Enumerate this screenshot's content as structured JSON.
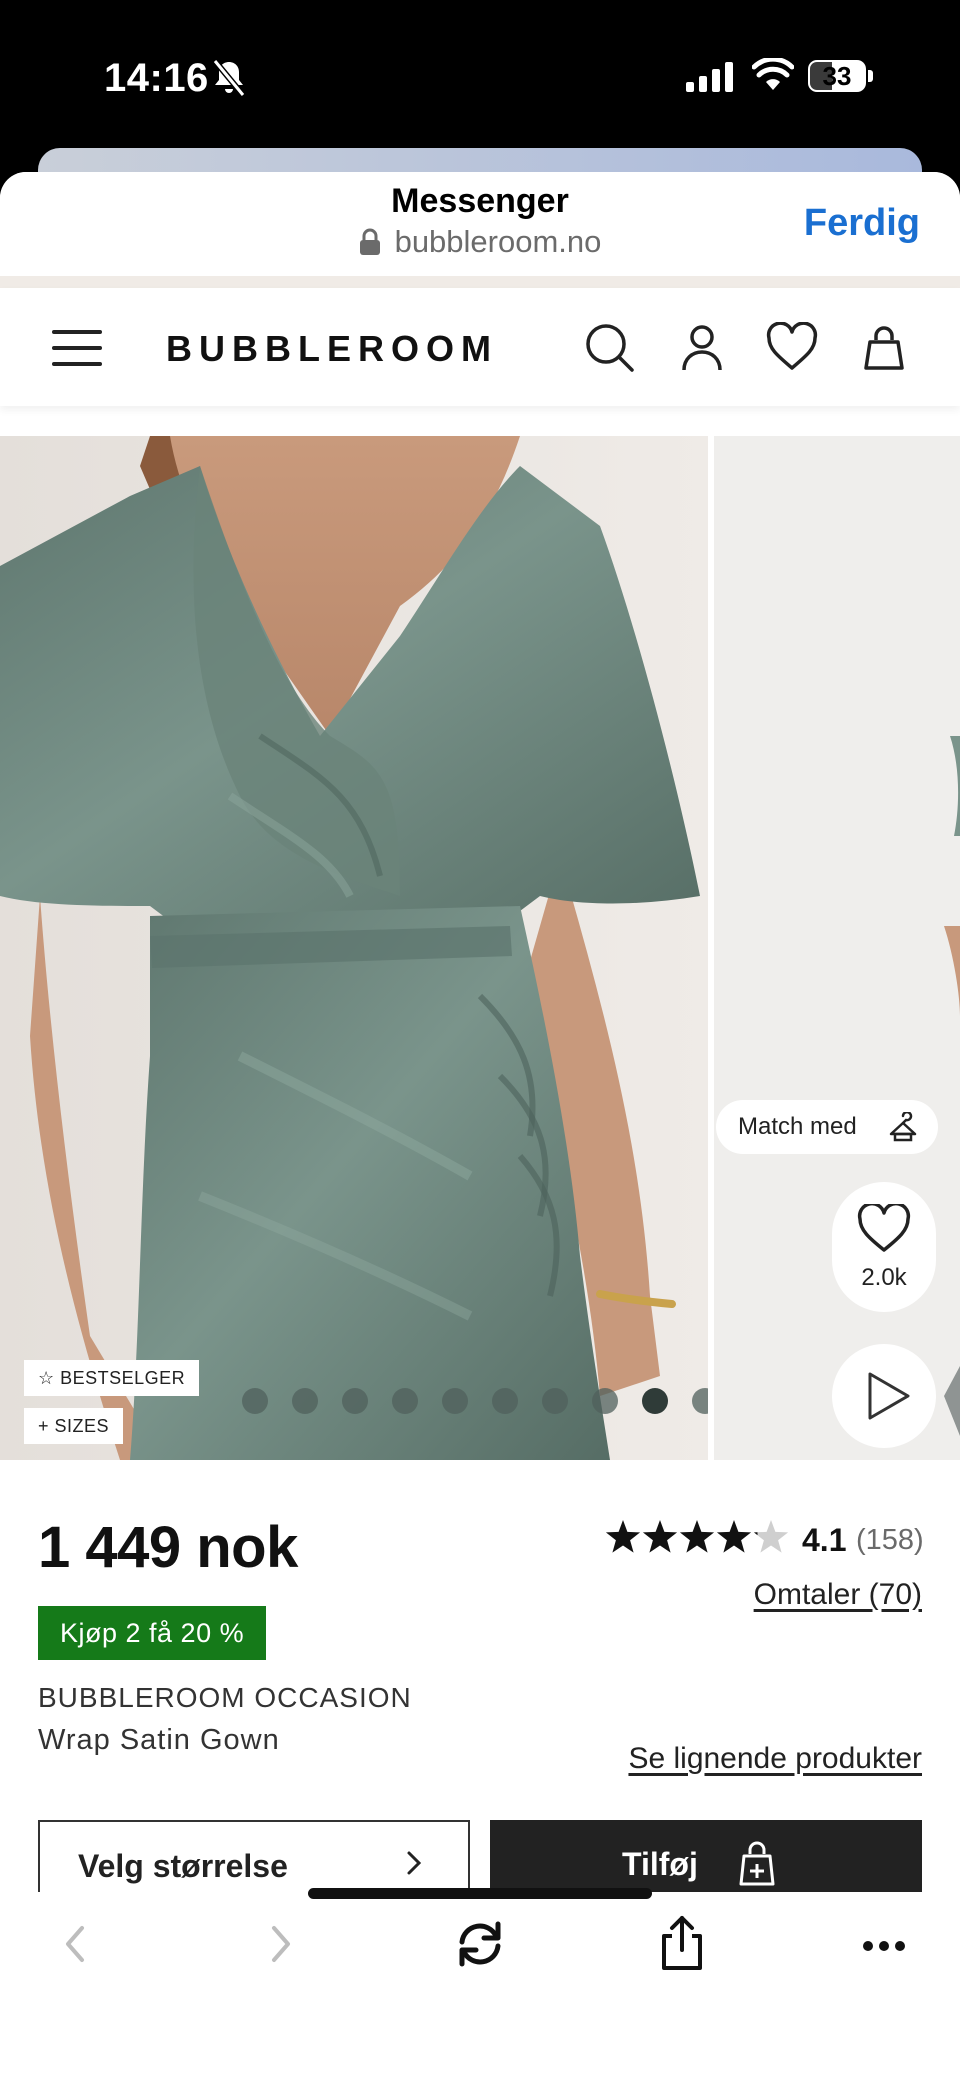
{
  "status_bar": {
    "time": "14:16",
    "battery": "33"
  },
  "browser": {
    "title": "Messenger",
    "url": "bubbleroom.no",
    "done_label": "Ferdig"
  },
  "site": {
    "logo": "BUBBLEROOM"
  },
  "gallery": {
    "badges": {
      "bestseller": "BESTSELGER",
      "sizes": "SIZES"
    },
    "match_label": "Match med",
    "wishlist_count": "2.0k",
    "dot_count": 10,
    "active_dot": 8
  },
  "product": {
    "price": "1 449 nok",
    "rating": "4.1",
    "rating_count": "(158)",
    "reviews_link": "Omtaler (70)",
    "promo": "Kjøp 2 få 20 %",
    "brand": "BUBBLEROOM OCCASION",
    "name": "Wrap Satin Gown",
    "similar_link": "Se lignende produkter",
    "select_size_label": "Velg størrelse",
    "add_label": "Tilføj"
  },
  "colors": {
    "promo_green": "#157a19",
    "link_blue": "#1a6fd1",
    "dress": "#6c857c"
  }
}
